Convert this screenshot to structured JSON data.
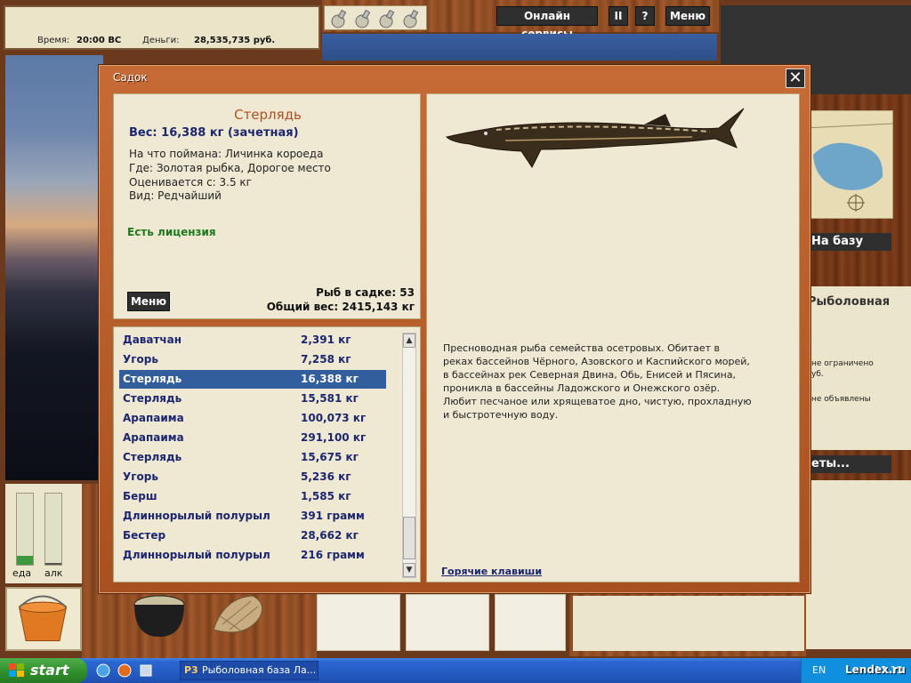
{
  "top_info": {
    "time_label": "Время:",
    "time_value": "20:00 ВС",
    "money_label": "Деньги:",
    "money_value": "28,535,735 руб."
  },
  "top_bar": {
    "online_services": "Онлайн сервисы",
    "pause": "II",
    "help": "?",
    "menu": "Меню"
  },
  "right_side": {
    "to_base": "На базу",
    "store_title": "Рыболовная",
    "store_line_1": "не ограничено",
    "store_line_2": "уб.",
    "store_line_3": "не объявлены",
    "tickets": "еты..."
  },
  "gauges": {
    "food_label": "еда",
    "alcohol_label": "алк",
    "food_level": 0.12,
    "alcohol_level": 0.02
  },
  "dialog": {
    "title": "Садок",
    "close": "✕",
    "fish": {
      "name": "Стерлядь",
      "weight": "Вес: 16,388 кг (зачетная)",
      "bait": "На что поймана: Личинка короеда",
      "place": "Где: Золотая рыбка, Дорогое место",
      "price": "Оценивается с: 3.5 кг",
      "kind": "Вид: Редчайший",
      "license": "Есть лицензия"
    },
    "menu_button": "Меню",
    "fish_count": "Рыб в садке: 53",
    "total_weight": "Общий вес: 2415,143 кг",
    "catch_list": [
      {
        "name": "Даватчан",
        "weight": "2,391 кг"
      },
      {
        "name": "Угорь",
        "weight": "7,258 кг"
      },
      {
        "name": "Стерлядь",
        "weight": "16,388 кг"
      },
      {
        "name": "Стерлядь",
        "weight": "15,581 кг"
      },
      {
        "name": "Арапаима",
        "weight": "100,073 кг"
      },
      {
        "name": "Арапаима",
        "weight": "291,100 кг"
      },
      {
        "name": "Стерлядь",
        "weight": "15,675 кг"
      },
      {
        "name": "Угорь",
        "weight": "5,236 кг"
      },
      {
        "name": "Берш",
        "weight": "1,585 кг"
      },
      {
        "name": "Длиннорылый полурыл",
        "weight": "391 грамм"
      },
      {
        "name": "Бестер",
        "weight": "28,662 кг"
      },
      {
        "name": "Длиннорылый полурыл",
        "weight": "216 грамм"
      }
    ],
    "selected_index": 2,
    "description": "Пресноводная рыба семейства осетровых. Обитает в\nреках бассейнов Чёрного, Азовского и Каспийского морей,\nв бассейнах рек Северная Двина, Обь, Енисей и Пясина,\nпроникла в бассейны Ладожского и Онежского озёр.\nЛюбит песчаное или хрящеватое дно, чистую, прохладную\nи быстротечную воду.",
    "hotkeys": "Горячие клавиши"
  },
  "taskbar": {
    "start": "start",
    "task": "Рыболовная база Ла...",
    "lang": "EN",
    "clock": "12:13"
  },
  "watermark": "Lendex.ru",
  "colors": {
    "accent_blue": "#1c2670",
    "selection": "#325e9e",
    "license_green": "#1f7a1f",
    "fish_name": "#b0501f"
  }
}
